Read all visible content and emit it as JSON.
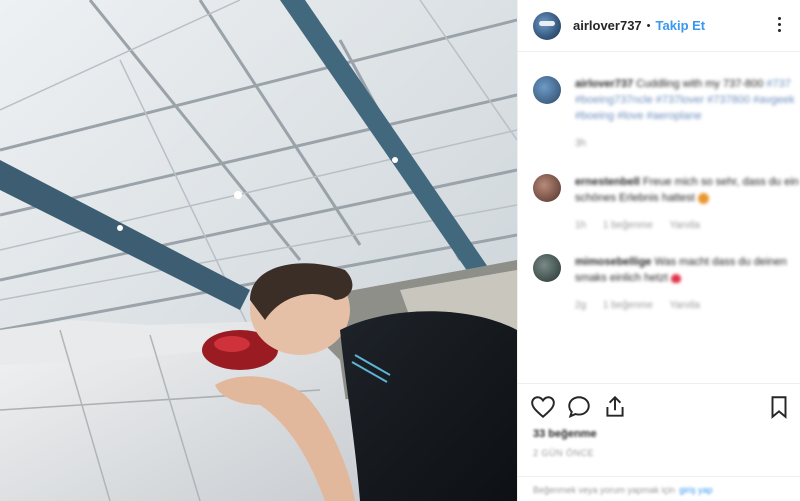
{
  "post": {
    "username": "airlover737",
    "follow_label": "Takip Et"
  },
  "comments": [
    {
      "username": "airlover737",
      "text": "Cuddling with my 737-800",
      "tags": "#737 #boeing737ncle #737lover #737800 #avgeek #boeing #love #aeroplane"
    },
    {
      "username": "ernestenbell",
      "text": "Freue mich so sehr, dass du ein schönes Erlebnis hattest"
    },
    {
      "username": "mimosebellige",
      "text": "Was macht dass du deinen smaks einlich hetzt"
    }
  ],
  "comment_meta": {
    "reply_label": "Yanıtla",
    "likes_label": "1 beğenme"
  },
  "footer": {
    "likes": "33 beğenme",
    "time": "2 GÜN ÖNCE",
    "login_prompt": "Beğenmek veya yorum yapmak için",
    "login_link": "giriş yap"
  },
  "colors": {
    "accent": "#3897f0",
    "heart": "#e0334a"
  },
  "icons": [
    "heart-icon",
    "comment-icon",
    "share-icon",
    "bookmark-icon",
    "more-options-icon"
  ]
}
